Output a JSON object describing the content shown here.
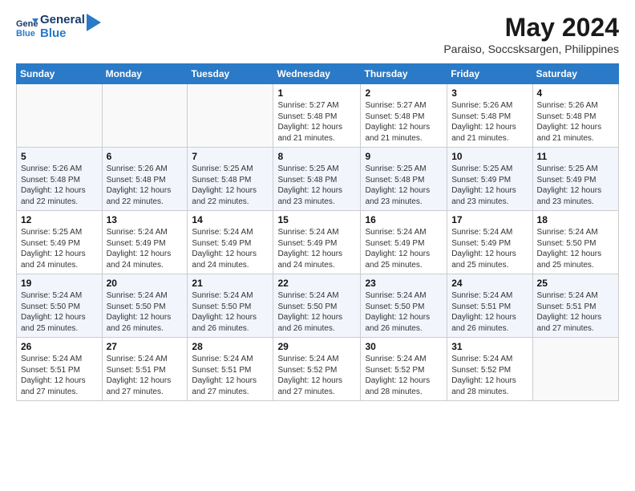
{
  "logo": {
    "line1": "General",
    "line2": "Blue"
  },
  "title": "May 2024",
  "subtitle": "Paraiso, Soccsksargen, Philippines",
  "days_header": [
    "Sunday",
    "Monday",
    "Tuesday",
    "Wednesday",
    "Thursday",
    "Friday",
    "Saturday"
  ],
  "weeks": [
    [
      {
        "day": "",
        "info": ""
      },
      {
        "day": "",
        "info": ""
      },
      {
        "day": "",
        "info": ""
      },
      {
        "day": "1",
        "info": "Sunrise: 5:27 AM\nSunset: 5:48 PM\nDaylight: 12 hours and 21 minutes."
      },
      {
        "day": "2",
        "info": "Sunrise: 5:27 AM\nSunset: 5:48 PM\nDaylight: 12 hours and 21 minutes."
      },
      {
        "day": "3",
        "info": "Sunrise: 5:26 AM\nSunset: 5:48 PM\nDaylight: 12 hours and 21 minutes."
      },
      {
        "day": "4",
        "info": "Sunrise: 5:26 AM\nSunset: 5:48 PM\nDaylight: 12 hours and 21 minutes."
      }
    ],
    [
      {
        "day": "5",
        "info": "Sunrise: 5:26 AM\nSunset: 5:48 PM\nDaylight: 12 hours and 22 minutes."
      },
      {
        "day": "6",
        "info": "Sunrise: 5:26 AM\nSunset: 5:48 PM\nDaylight: 12 hours and 22 minutes."
      },
      {
        "day": "7",
        "info": "Sunrise: 5:25 AM\nSunset: 5:48 PM\nDaylight: 12 hours and 22 minutes."
      },
      {
        "day": "8",
        "info": "Sunrise: 5:25 AM\nSunset: 5:48 PM\nDaylight: 12 hours and 23 minutes."
      },
      {
        "day": "9",
        "info": "Sunrise: 5:25 AM\nSunset: 5:48 PM\nDaylight: 12 hours and 23 minutes."
      },
      {
        "day": "10",
        "info": "Sunrise: 5:25 AM\nSunset: 5:49 PM\nDaylight: 12 hours and 23 minutes."
      },
      {
        "day": "11",
        "info": "Sunrise: 5:25 AM\nSunset: 5:49 PM\nDaylight: 12 hours and 23 minutes."
      }
    ],
    [
      {
        "day": "12",
        "info": "Sunrise: 5:25 AM\nSunset: 5:49 PM\nDaylight: 12 hours and 24 minutes."
      },
      {
        "day": "13",
        "info": "Sunrise: 5:24 AM\nSunset: 5:49 PM\nDaylight: 12 hours and 24 minutes."
      },
      {
        "day": "14",
        "info": "Sunrise: 5:24 AM\nSunset: 5:49 PM\nDaylight: 12 hours and 24 minutes."
      },
      {
        "day": "15",
        "info": "Sunrise: 5:24 AM\nSunset: 5:49 PM\nDaylight: 12 hours and 24 minutes."
      },
      {
        "day": "16",
        "info": "Sunrise: 5:24 AM\nSunset: 5:49 PM\nDaylight: 12 hours and 25 minutes."
      },
      {
        "day": "17",
        "info": "Sunrise: 5:24 AM\nSunset: 5:49 PM\nDaylight: 12 hours and 25 minutes."
      },
      {
        "day": "18",
        "info": "Sunrise: 5:24 AM\nSunset: 5:50 PM\nDaylight: 12 hours and 25 minutes."
      }
    ],
    [
      {
        "day": "19",
        "info": "Sunrise: 5:24 AM\nSunset: 5:50 PM\nDaylight: 12 hours and 25 minutes."
      },
      {
        "day": "20",
        "info": "Sunrise: 5:24 AM\nSunset: 5:50 PM\nDaylight: 12 hours and 26 minutes."
      },
      {
        "day": "21",
        "info": "Sunrise: 5:24 AM\nSunset: 5:50 PM\nDaylight: 12 hours and 26 minutes."
      },
      {
        "day": "22",
        "info": "Sunrise: 5:24 AM\nSunset: 5:50 PM\nDaylight: 12 hours and 26 minutes."
      },
      {
        "day": "23",
        "info": "Sunrise: 5:24 AM\nSunset: 5:50 PM\nDaylight: 12 hours and 26 minutes."
      },
      {
        "day": "24",
        "info": "Sunrise: 5:24 AM\nSunset: 5:51 PM\nDaylight: 12 hours and 26 minutes."
      },
      {
        "day": "25",
        "info": "Sunrise: 5:24 AM\nSunset: 5:51 PM\nDaylight: 12 hours and 27 minutes."
      }
    ],
    [
      {
        "day": "26",
        "info": "Sunrise: 5:24 AM\nSunset: 5:51 PM\nDaylight: 12 hours and 27 minutes."
      },
      {
        "day": "27",
        "info": "Sunrise: 5:24 AM\nSunset: 5:51 PM\nDaylight: 12 hours and 27 minutes."
      },
      {
        "day": "28",
        "info": "Sunrise: 5:24 AM\nSunset: 5:51 PM\nDaylight: 12 hours and 27 minutes."
      },
      {
        "day": "29",
        "info": "Sunrise: 5:24 AM\nSunset: 5:52 PM\nDaylight: 12 hours and 27 minutes."
      },
      {
        "day": "30",
        "info": "Sunrise: 5:24 AM\nSunset: 5:52 PM\nDaylight: 12 hours and 28 minutes."
      },
      {
        "day": "31",
        "info": "Sunrise: 5:24 AM\nSunset: 5:52 PM\nDaylight: 12 hours and 28 minutes."
      },
      {
        "day": "",
        "info": ""
      }
    ]
  ]
}
